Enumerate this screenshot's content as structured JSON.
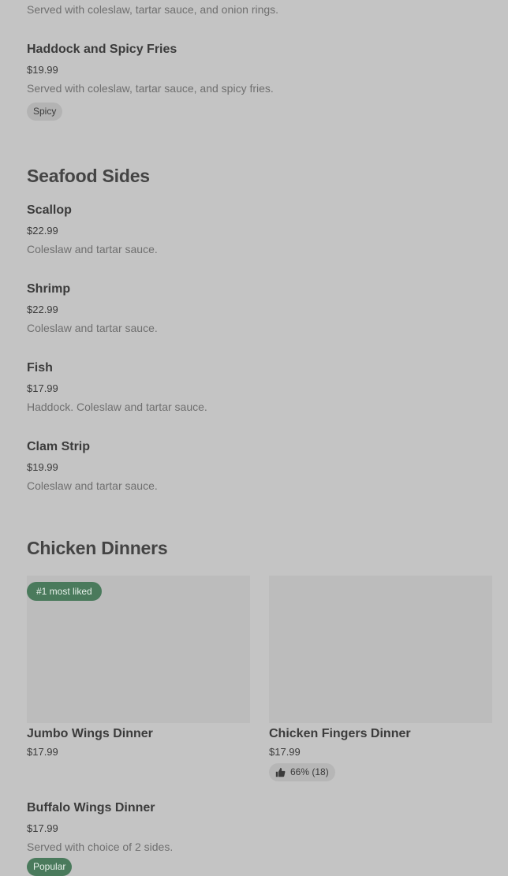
{
  "menu": {
    "top_item": {
      "desc": "Served with coleslaw, tartar sauce, and onion rings."
    },
    "haddock_spicy": {
      "name": "Haddock and Spicy Fries",
      "price": "$19.99",
      "desc": "Served with coleslaw, tartar sauce, and spicy fries.",
      "tag": "Spicy"
    },
    "seafood_sides": {
      "title": "Seafood Sides",
      "items": [
        {
          "name": "Scallop",
          "price": "$22.99",
          "desc": "Coleslaw and tartar sauce."
        },
        {
          "name": "Shrimp",
          "price": "$22.99",
          "desc": "Coleslaw and tartar sauce."
        },
        {
          "name": "Fish",
          "price": "$17.99",
          "desc": "Haddock. Coleslaw and tartar sauce."
        },
        {
          "name": "Clam Strip",
          "price": "$19.99",
          "desc": "Coleslaw and tartar sauce."
        }
      ]
    },
    "chicken_dinners": {
      "title": "Chicken Dinners",
      "cards": [
        {
          "name": "Jumbo Wings Dinner",
          "price": "$17.99",
          "badge": "#1 most liked"
        },
        {
          "name": "Chicken Fingers Dinner",
          "price": "$17.99",
          "rating": "66% (18)"
        }
      ],
      "buffalo": {
        "name": "Buffalo Wings Dinner",
        "price": "$17.99",
        "desc": "Served with choice of 2 sides.",
        "tag": "Popular"
      }
    }
  },
  "colors": {
    "background": "#c4c4c4",
    "accent_green": "#4a7a5c"
  },
  "icons": {
    "rating": "thumbs-up-icon"
  }
}
